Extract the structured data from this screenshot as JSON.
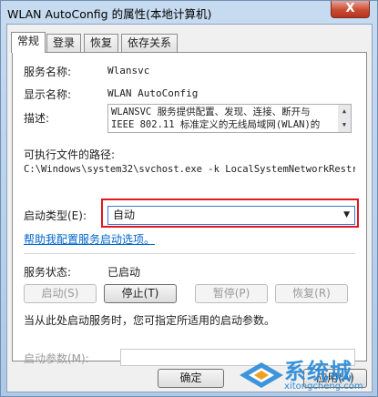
{
  "window": {
    "title": "WLAN AutoConfig 的属性(本地计算机)",
    "close_label": "X"
  },
  "tabs": [
    {
      "label": "常规",
      "active": true
    },
    {
      "label": "登录",
      "active": false
    },
    {
      "label": "恢复",
      "active": false
    },
    {
      "label": "依存关系",
      "active": false
    }
  ],
  "general": {
    "service_name_label": "服务名称:",
    "service_name_value": "Wlansvc",
    "display_name_label": "显示名称:",
    "display_name_value": "WLAN AutoConfig",
    "description_label": "描述:",
    "description_lines": [
      "WLANSVC 服务提供配置、发现、连接、断开与",
      "IEEE 802.11 标准定义的无线局域网(WLAN)的"
    ],
    "path_label": "可执行文件的路径:",
    "path_value": "C:\\Windows\\system32\\svchost.exe -k LocalSystemNetworkRestric",
    "startup_type_label": "启动类型(E):",
    "startup_type_value": "自动",
    "help_link": "帮助我配置服务启动选项。",
    "status_label": "服务状态:",
    "status_value": "已启动",
    "buttons": {
      "start": "启动(S)",
      "stop": "停止(T)",
      "pause": "暂停(P)",
      "resume": "恢复(R)"
    },
    "hint": "当从此处启动服务时，您可指定所适用的启动参数。",
    "start_params_label": "启动参数(M):",
    "start_params_value": ""
  },
  "footer": {
    "ok": "确定",
    "apply": "应用(A)"
  },
  "watermark": {
    "brand": "系统城",
    "url": "xitongcheng.com"
  },
  "colors": {
    "highlight": "#e0181d",
    "link": "#0066cc",
    "watermark": "#2a8bd8"
  }
}
